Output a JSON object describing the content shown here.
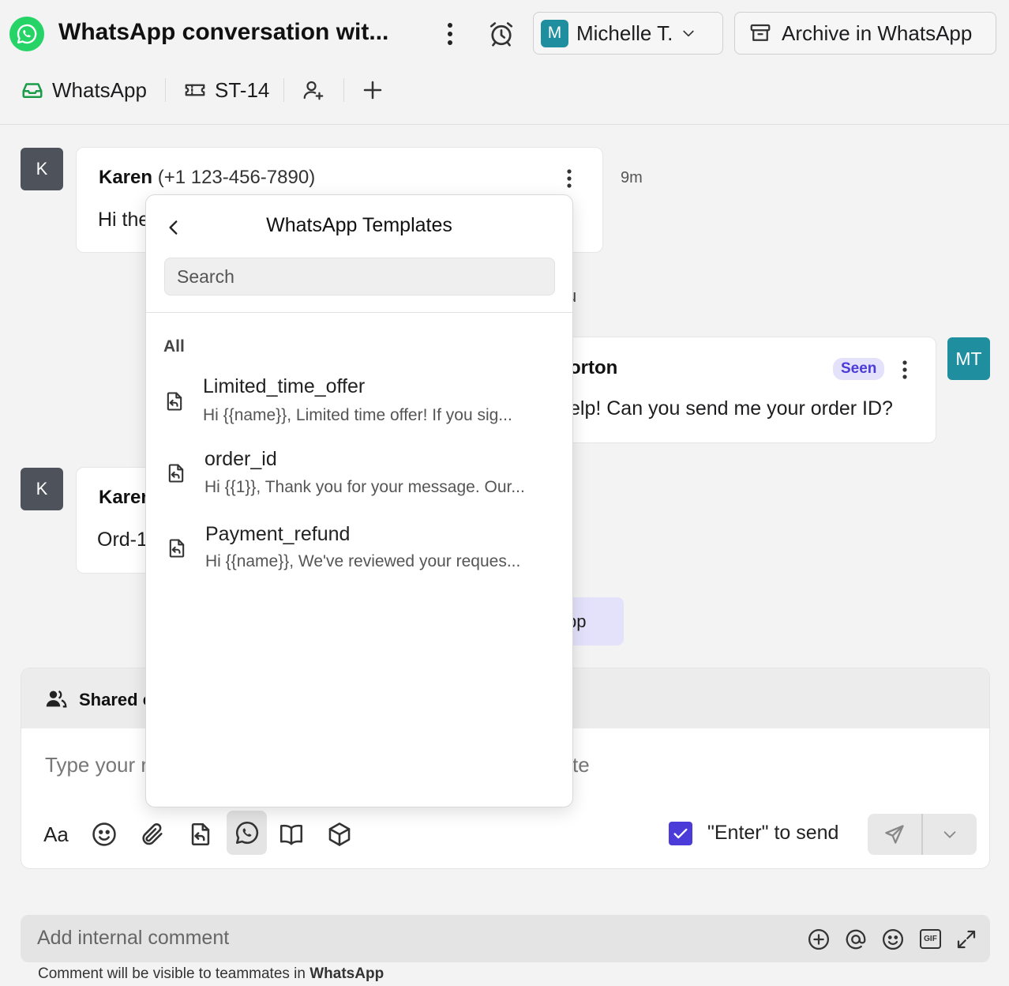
{
  "header": {
    "title": "WhatsApp conversation wit...",
    "assignee": {
      "initial": "M",
      "name": "Michelle T."
    },
    "archive_label": "Archive in WhatsApp"
  },
  "subbar": {
    "channel": "WhatsApp",
    "ticket": "ST-14"
  },
  "messages": [
    {
      "avatar": "K",
      "sender": "Karen",
      "phone": "(+1 123-456-7890)",
      "text": "Hi the",
      "time": "9m"
    },
    {
      "fragment": "u"
    },
    {
      "avatar": "MT",
      "sender_fragment": "orton",
      "status": "Seen",
      "text": "elp! Can you send me your order ID?"
    },
    {
      "avatar": "K",
      "sender": "Karen",
      "text": "Ord-1"
    },
    {
      "fragment": "pp"
    }
  ],
  "composer": {
    "header_label": "Shared c",
    "placeholder": "Type your r",
    "placeholder_tail": "te",
    "format_label": "Aa",
    "enter_to_send": "\"Enter\" to send",
    "enter_checked": true
  },
  "comment": {
    "placeholder": "Add internal comment",
    "note_prefix": "Comment will be visible to teammates in ",
    "note_bold": "WhatsApp",
    "gif_label": "GIF"
  },
  "templates_popover": {
    "title": "WhatsApp Templates",
    "search_placeholder": "Search",
    "category": "All",
    "items": [
      {
        "name": "Limited_time_offer",
        "preview": "Hi {{name}}, Limited time offer! If you sig..."
      },
      {
        "name": "order_id",
        "preview": "Hi {{1}}, Thank you for your message. Our..."
      },
      {
        "name": "Payment_refund",
        "preview": "Hi {{name}}, We've reviewed your reques..."
      }
    ]
  },
  "colors": {
    "whatsapp_green": "#25d366",
    "assignee_teal": "#1f8fa0",
    "accent_purple": "#4b3bd9",
    "avatar_gray": "#4e525a"
  }
}
